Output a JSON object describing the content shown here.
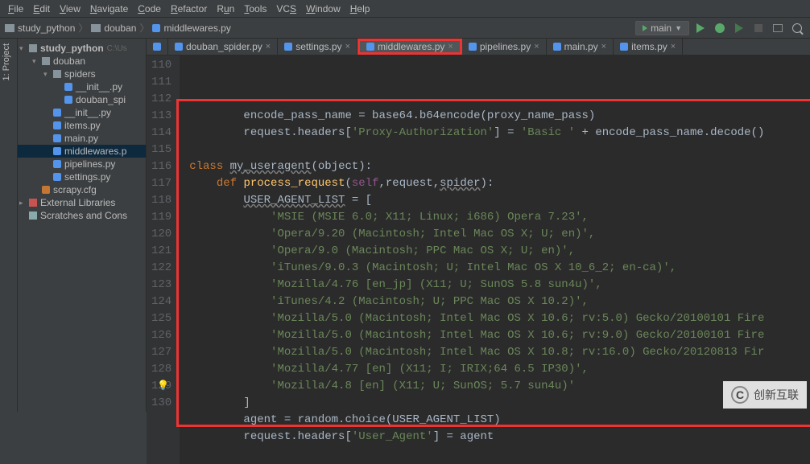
{
  "menu": {
    "items": [
      "File",
      "Edit",
      "View",
      "Navigate",
      "Code",
      "Refactor",
      "Run",
      "Tools",
      "VCS",
      "Window",
      "Help"
    ]
  },
  "breadcrumb": {
    "project": "study_python",
    "folder": "douban",
    "file": "middlewares.py"
  },
  "run": {
    "config": "main"
  },
  "tree": {
    "root": "study_python",
    "root_hint": "C:\\Us",
    "nodes": [
      {
        "indent": 1,
        "type": "folder",
        "name": "douban",
        "arrow": "▾"
      },
      {
        "indent": 2,
        "type": "folder",
        "name": "spiders",
        "arrow": "▾"
      },
      {
        "indent": 3,
        "type": "py",
        "name": "__init__.py"
      },
      {
        "indent": 3,
        "type": "py",
        "name": "douban_spi"
      },
      {
        "indent": 2,
        "type": "py",
        "name": "__init__.py"
      },
      {
        "indent": 2,
        "type": "py",
        "name": "items.py"
      },
      {
        "indent": 2,
        "type": "py",
        "name": "main.py"
      },
      {
        "indent": 2,
        "type": "py",
        "name": "middlewares.p",
        "selected": true
      },
      {
        "indent": 2,
        "type": "py",
        "name": "pipelines.py"
      },
      {
        "indent": 2,
        "type": "py",
        "name": "settings.py"
      },
      {
        "indent": 1,
        "type": "cfg",
        "name": "scrapy.cfg"
      }
    ],
    "external": "External Libraries",
    "scratches": "Scratches and Cons"
  },
  "tabs": [
    {
      "label": "",
      "icon_only": true
    },
    {
      "label": "douban_spider.py"
    },
    {
      "label": "settings.py"
    },
    {
      "label": "middlewares.py",
      "active": true,
      "redbox": true
    },
    {
      "label": "pipelines.py"
    },
    {
      "label": "main.py"
    },
    {
      "label": "items.py"
    }
  ],
  "gutter": {
    "start": 110,
    "end": 130
  },
  "code": {
    "l110": {
      "a": "        encode_pass_name = base64.b64encode(proxy_name_pass)"
    },
    "l111": {
      "a": "        request.headers[",
      "b": "'Proxy-Authorization'",
      "c": "] = ",
      "d": "'Basic '",
      "e": " + encode_pass_name.decode()"
    },
    "l113": {
      "kw": "class",
      "name": "my_useragent",
      "paren": "(object):"
    },
    "l114": {
      "kw": "def",
      "name": "process_request",
      "params": "(self,request,spider):"
    },
    "l115": {
      "var": "USER_AGENT_LIST",
      "rest": " = ["
    },
    "l116": "'MSIE (MSIE 6.0; X11; Linux; i686) Opera 7.23',",
    "l117": "'Opera/9.20 (Macintosh; Intel Mac OS X; U; en)',",
    "l118": "'Opera/9.0 (Macintosh; PPC Mac OS X; U; en)',",
    "l119": "'iTunes/9.0.3 (Macintosh; U; Intel Mac OS X 10_6_2; en-ca)',",
    "l120": "'Mozilla/4.76 [en_jp] (X11; U; SunOS 5.8 sun4u)',",
    "l121": "'iTunes/4.2 (Macintosh; U; PPC Mac OS X 10.2)',",
    "l122": "'Mozilla/5.0 (Macintosh; Intel Mac OS X 10.6; rv:5.0) Gecko/20100101 Fire",
    "l123": "'Mozilla/5.0 (Macintosh; Intel Mac OS X 10.6; rv:9.0) Gecko/20100101 Fire",
    "l124": "'Mozilla/5.0 (Macintosh; Intel Mac OS X 10.8; rv:16.0) Gecko/20120813 Fir",
    "l125": "'Mozilla/4.77 [en] (X11; I; IRIX;64 6.5 IP30)',",
    "l126": "'Mozilla/4.8 [en] (X11; U; SunOS; 5.7 sun4u)'",
    "l127": "        ]",
    "l128": {
      "a": "        agent = random.choice(USER_AGENT_LIST)"
    },
    "l129": {
      "a": "        request.headers[",
      "b": "'User_Agent'",
      "c": "] = agent"
    }
  },
  "watermark": {
    "text": "创新互联"
  },
  "project_tool": {
    "label": "1: Project"
  }
}
